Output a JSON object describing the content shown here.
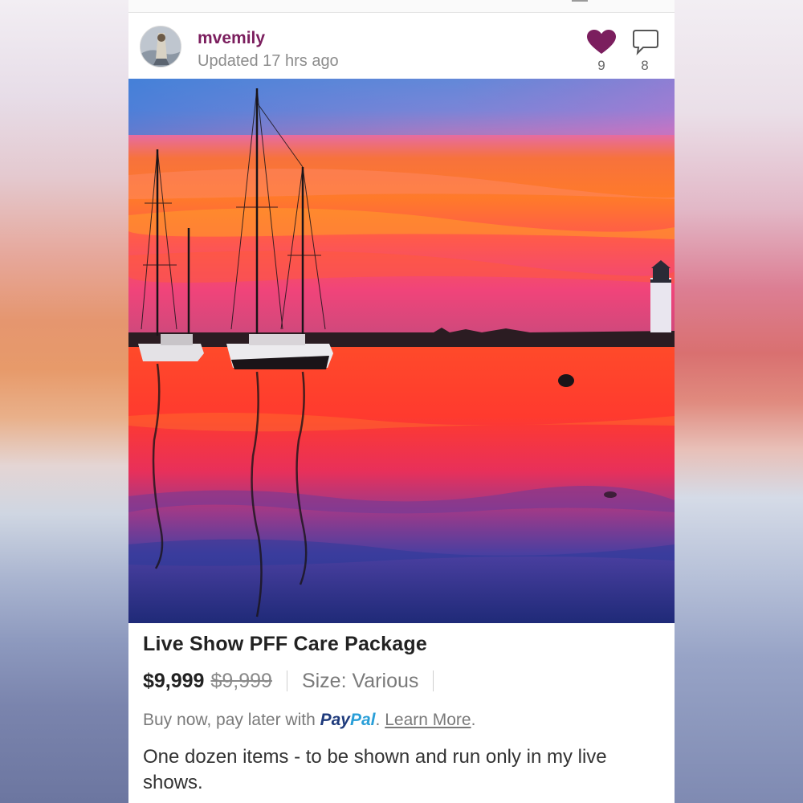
{
  "post": {
    "username": "mvemily",
    "updated": "Updated 17 hrs ago",
    "likes": "9",
    "comments": "8"
  },
  "listing": {
    "title": "Live Show PFF Care Package",
    "price": "$9,999",
    "original_price": "$9,999",
    "size": "Size: Various",
    "paypal_prefix": "Buy now, pay later with",
    "paypal_pay": "Pay",
    "paypal_pal": "Pal",
    "paypal_period": ".",
    "learn_more": "Learn More",
    "learn_more_period": ".",
    "description": "One dozen items - to be shown and run only in my live shows."
  },
  "icons": {
    "like": "heart-icon",
    "comment": "comment-bubble-icon"
  },
  "colors": {
    "username": "#7b1e5e",
    "heart": "#7b1e5e",
    "paypal_dark": "#1f3b7c",
    "paypal_light": "#2a9fd8"
  }
}
